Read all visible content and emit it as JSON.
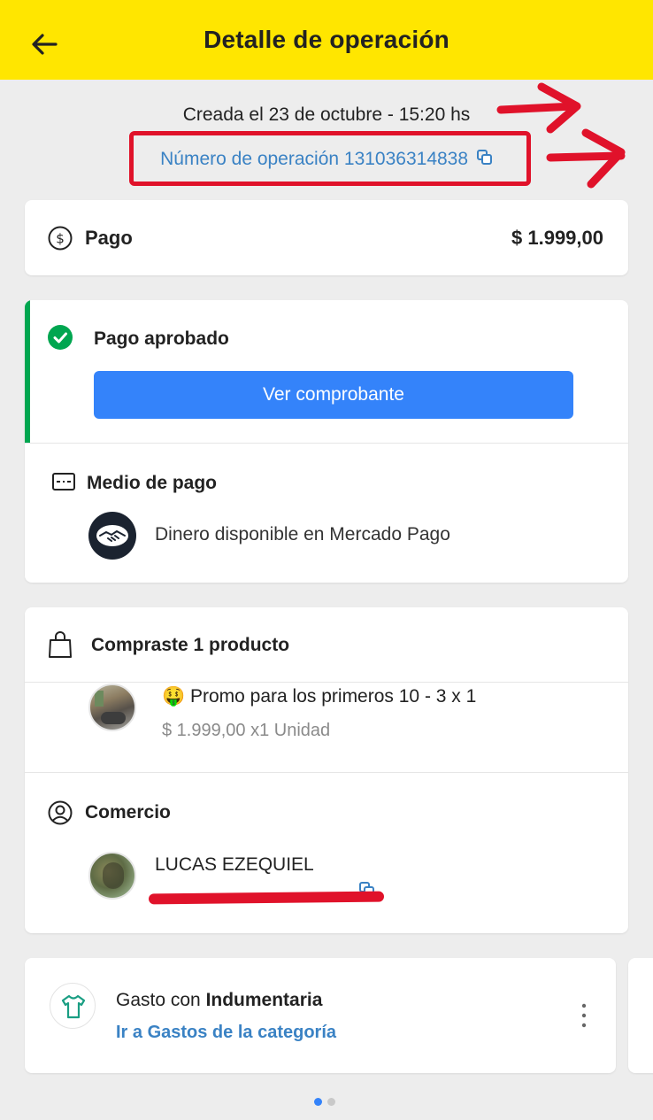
{
  "header": {
    "title": "Detalle de operación"
  },
  "operation": {
    "created": "Creada el 23 de octubre - 15:20 hs",
    "number_label": "Número de operación 131036314838"
  },
  "payment": {
    "label": "Pago",
    "amount": "$ 1.999,00"
  },
  "status": {
    "label": "Pago aprobado",
    "button": "Ver comprobante"
  },
  "method": {
    "title": "Medio de pago",
    "value": "Dinero disponible en Mercado Pago"
  },
  "purchase": {
    "title": "Compraste 1 producto",
    "product_emoji": "🤑",
    "product_name": "Promo para los primeros 10 - 3 x 1",
    "product_price": "$ 1.999,00 x1 Unidad"
  },
  "merchant": {
    "title": "Comercio",
    "name": "LUCAS EZEQUIEL"
  },
  "category": {
    "prefix": "Gasto con ",
    "name": "Indumentaria",
    "link": "Ir a Gastos de la categoría"
  },
  "colors": {
    "header_bg": "#ffe600",
    "accent_blue": "#3483fa",
    "link_blue": "#3a82c4",
    "success_green": "#00a650",
    "annotation_red": "#e0122a"
  },
  "icons": {
    "back": "arrow-left-icon",
    "copy": "copy-icon",
    "dollar": "dollar-circle-icon",
    "check": "check-circle-icon",
    "card": "card-icon",
    "mercadopago": "handshake-logo",
    "bag": "shopping-bag-icon",
    "user": "user-circle-icon",
    "shirt": "shirt-icon",
    "more": "more-vertical-icon"
  },
  "pagination": {
    "total": 2,
    "active": 1
  }
}
